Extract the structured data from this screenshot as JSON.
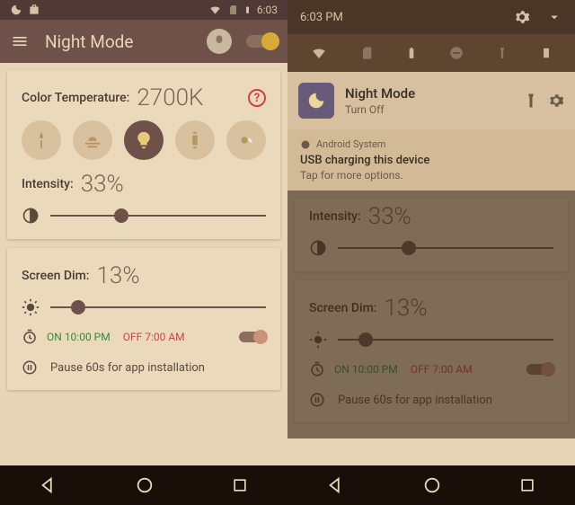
{
  "status": {
    "time": "6:03"
  },
  "appbar": {
    "title": "Night Mode"
  },
  "card1": {
    "ct_label": "Color Temperature:",
    "ct_value": "2700K",
    "intensity_label": "Intensity:",
    "intensity_value": "33%",
    "intensity_pct": 33
  },
  "card2": {
    "dim_label": "Screen Dim:",
    "dim_value": "13%",
    "dim_pct": 13,
    "on_label": "ON",
    "on_time": "10:00 PM",
    "off_label": "OFF",
    "off_time": "7:00 AM",
    "pause_label": "Pause 60s for app installation"
  },
  "shade": {
    "time": "6:03 PM"
  },
  "notif": {
    "title": "Night Mode",
    "sub": "Turn Off"
  },
  "sys": {
    "src": "Android System",
    "title": "USB charging this device",
    "sub": "Tap for more options."
  }
}
